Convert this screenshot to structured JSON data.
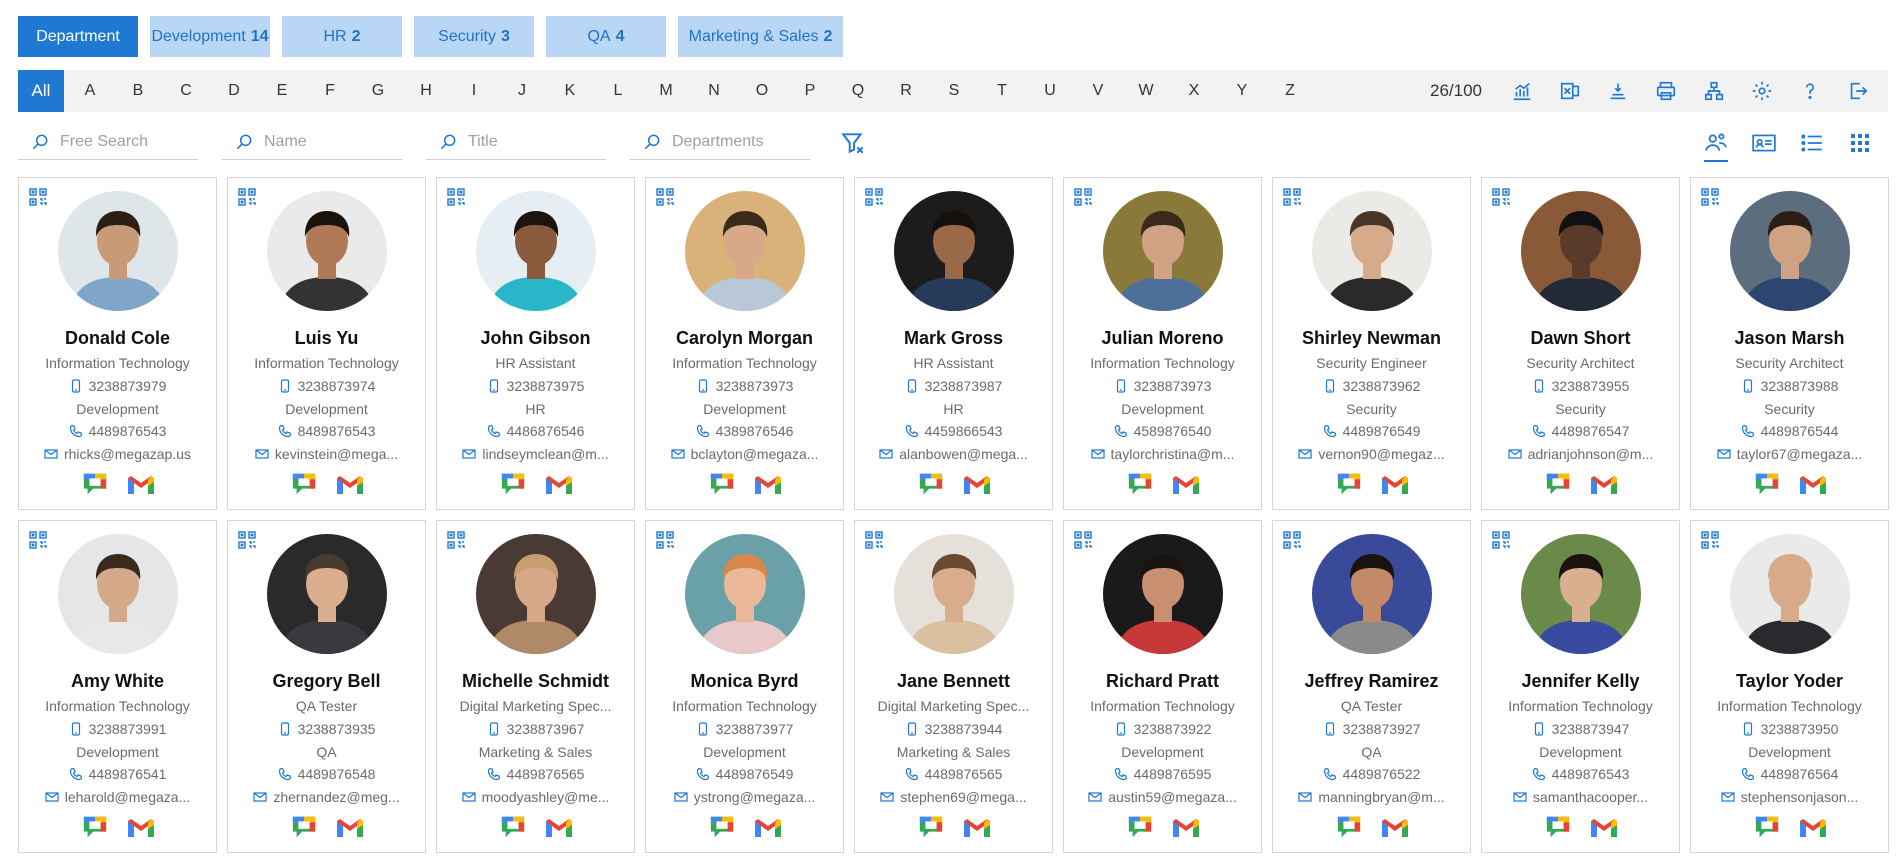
{
  "departments": [
    {
      "label": "Department",
      "count": ""
    },
    {
      "label": "Development",
      "count": "14"
    },
    {
      "label": "HR",
      "count": "2"
    },
    {
      "label": "Security",
      "count": "3"
    },
    {
      "label": "QA",
      "count": "4"
    },
    {
      "label": "Marketing & Sales",
      "count": "2"
    }
  ],
  "alphabet": {
    "all": "All",
    "letters": [
      "A",
      "B",
      "C",
      "D",
      "E",
      "F",
      "G",
      "H",
      "I",
      "J",
      "K",
      "L",
      "M",
      "N",
      "O",
      "P",
      "Q",
      "R",
      "S",
      "T",
      "U",
      "V",
      "W",
      "X",
      "Y",
      "Z"
    ]
  },
  "record_count": "26/100",
  "search": {
    "free": "Free Search",
    "name": "Name",
    "title": "Title",
    "departments": "Departments"
  },
  "colors": {
    "accent": "#1f78d1",
    "chip_bg": "#b9d7f5"
  },
  "employees": [
    {
      "name": "Donald Cole",
      "title": "Information Technology",
      "cell": "3238873979",
      "dept": "Development",
      "phone": "4489876543",
      "email": "rhicks@megazap.us",
      "skin": "#c89a78",
      "hair": "#2c1f16",
      "shirt": "#7fa6c9",
      "bg": "#dfe6ea"
    },
    {
      "name": "Luis Yu",
      "title": "Information Technology",
      "cell": "3238873974",
      "dept": "Development",
      "phone": "8489876543",
      "email": "kevinstein@mega...",
      "skin": "#b07a58",
      "hair": "#1a120d",
      "shirt": "#333333",
      "bg": "#eaeaea"
    },
    {
      "name": "John Gibson",
      "title": "HR Assistant",
      "cell": "3238873975",
      "dept": "HR",
      "phone": "4486876546",
      "email": "lindseymclean@m...",
      "skin": "#8a5a3c",
      "hair": "#1b1410",
      "shirt": "#29b6c8",
      "bg": "#e6eef3"
    },
    {
      "name": "Carolyn Morgan",
      "title": "Information Technology",
      "cell": "3238873973",
      "dept": "Development",
      "phone": "4389876546",
      "email": "bclayton@megaza...",
      "skin": "#d8a888",
      "hair": "#3a2a1c",
      "shirt": "#b8c8d8",
      "bg": "#d9b27a"
    },
    {
      "name": "Mark Gross",
      "title": "HR Assistant",
      "cell": "3238873987",
      "dept": "HR",
      "phone": "4459866543",
      "email": "alanbowen@mega...",
      "skin": "#9a6a48",
      "hair": "#15100c",
      "shirt": "#283a5a",
      "bg": "#1c1c1c"
    },
    {
      "name": "Julian Moreno",
      "title": "Information Technology",
      "cell": "3238873973",
      "dept": "Development",
      "phone": "4589876540",
      "email": "taylorchristina@m...",
      "skin": "#d1a283",
      "hair": "#3a2a1c",
      "shirt": "#4e6f9a",
      "bg": "#8a7a3a"
    },
    {
      "name": "Shirley Newman",
      "title": "Security Engineer",
      "cell": "3238873962",
      "dept": "Security",
      "phone": "4489876549",
      "email": "vernon90@megaz...",
      "skin": "#d6ab8c",
      "hair": "#4a3626",
      "shirt": "#2a2a2a",
      "bg": "#eceae6"
    },
    {
      "name": "Dawn Short",
      "title": "Security Architect",
      "cell": "3238873955",
      "dept": "Security",
      "phone": "4489876547",
      "email": "adrianjohnson@m...",
      "skin": "#5a3a28",
      "hair": "#111111",
      "shirt": "#222a38",
      "bg": "#8a5a38"
    },
    {
      "name": "Jason Marsh",
      "title": "Security Architect",
      "cell": "3238873988",
      "dept": "Security",
      "phone": "4489876544",
      "email": "taylor67@megaza...",
      "skin": "#cfa283",
      "hair": "#2a1e16",
      "shirt": "#2c4670",
      "bg": "#5c6e7e"
    },
    {
      "name": "Amy White",
      "title": "Information Technology",
      "cell": "3238873991",
      "dept": "Development",
      "phone": "4489876541",
      "email": "leharold@megaza...",
      "skin": "#d4a888",
      "hair": "#3a2a1c",
      "shirt": "#e8e8ea",
      "bg": "#e4e6e8"
    },
    {
      "name": "Gregory Bell",
      "title": "QA Tester",
      "cell": "3238873935",
      "dept": "QA",
      "phone": "4489876548",
      "email": "zhernandez@meg...",
      "skin": "#d9ad8e",
      "hair": "#4a3a2e",
      "shirt": "#3a3a3e",
      "bg": "#2a2a2a"
    },
    {
      "name": "Michelle Schmidt",
      "title": "Digital Marketing Spec...",
      "cell": "3238873967",
      "dept": "Marketing & Sales",
      "phone": "4489876565",
      "email": "moodyashley@me...",
      "skin": "#d6a888",
      "hair": "#c8a070",
      "shirt": "#b08a68",
      "bg": "#4a3a34"
    },
    {
      "name": "Monica Byrd",
      "title": "Information Technology",
      "cell": "3238873977",
      "dept": "Development",
      "phone": "4489876549",
      "email": "ystrong@megaza...",
      "skin": "#eab898",
      "hair": "#d8864a",
      "shirt": "#e8c8c8",
      "bg": "#6aa0a8"
    },
    {
      "name": "Jane Bennett",
      "title": "Digital Marketing Spec...",
      "cell": "3238873944",
      "dept": "Marketing & Sales",
      "phone": "4489876565",
      "email": "stephen69@mega...",
      "skin": "#d8ac8c",
      "hair": "#6a4a30",
      "shirt": "#d8c0a0",
      "bg": "#e6e0da"
    },
    {
      "name": "Richard Pratt",
      "title": "Information Technology",
      "cell": "3238873922",
      "dept": "Development",
      "phone": "4489876595",
      "email": "austin59@megaza...",
      "skin": "#c89070",
      "hair": "#1a1410",
      "shirt": "#c83838",
      "bg": "#1a1a1a"
    },
    {
      "name": "Jeffrey Ramirez",
      "title": "QA Tester",
      "cell": "3238873927",
      "dept": "QA",
      "phone": "4489876522",
      "email": "manningbryan@m...",
      "skin": "#c48a68",
      "hair": "#1a120e",
      "shirt": "#8a8a8a",
      "bg": "#3a4a9a"
    },
    {
      "name": "Jennifer Kelly",
      "title": "Information Technology",
      "cell": "3238873947",
      "dept": "Development",
      "phone": "4489876543",
      "email": "samanthacooper...",
      "skin": "#d8b090",
      "hair": "#1a1410",
      "shirt": "#3a4aa0",
      "bg": "#6a8a4a"
    },
    {
      "name": "Taylor Yoder",
      "title": "Information Technology",
      "cell": "3238873950",
      "dept": "Development",
      "phone": "4489876564",
      "email": "stephensonjason...",
      "skin": "#d8aa8a",
      "hair": "#d8aa8a",
      "shirt": "#2a2a2e",
      "bg": "#eaeaea"
    }
  ]
}
